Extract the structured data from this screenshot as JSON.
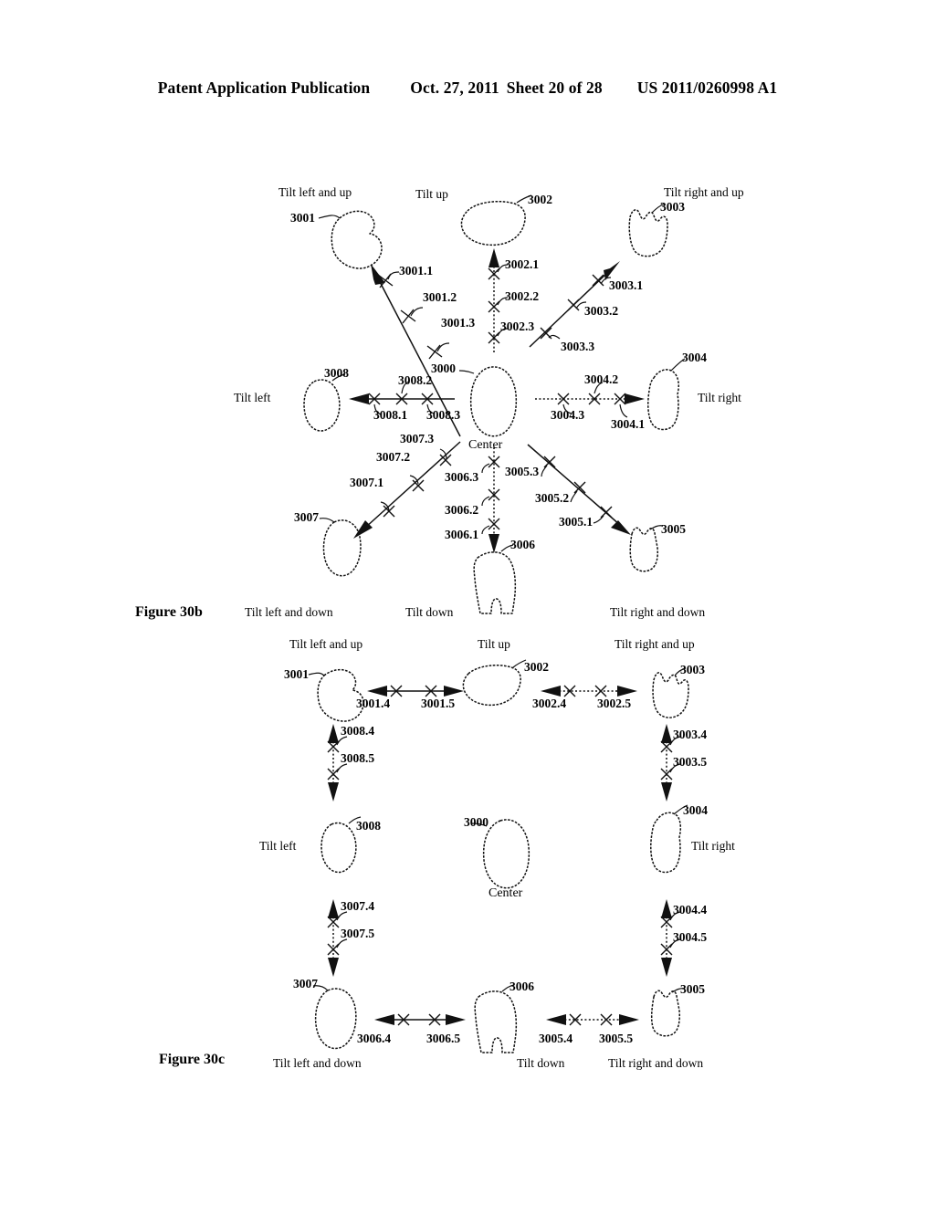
{
  "header": {
    "publication": "Patent Application Publication",
    "date": "Oct. 27, 2011",
    "sheet": "Sheet 20 of 28",
    "number": "US 2011/0260998 A1"
  },
  "figures": [
    {
      "name": "Figure 30b",
      "center": {
        "ref": "3000",
        "label": "Center"
      },
      "directions": [
        {
          "key": "tilt-left-and-up",
          "caption": "Tilt left and up",
          "shape_ref": "3001",
          "ticks": [
            "3001.1",
            "3001.2",
            "3001.3"
          ]
        },
        {
          "key": "tilt-up",
          "caption": "Tilt up",
          "shape_ref": "3002",
          "ticks": [
            "3002.1",
            "3002.2",
            "3002.3"
          ]
        },
        {
          "key": "tilt-right-and-up",
          "caption": "Tilt right and up",
          "shape_ref": "3003",
          "ticks": [
            "3003.1",
            "3003.2",
            "3003.3"
          ]
        },
        {
          "key": "tilt-right",
          "caption": "Tilt right",
          "shape_ref": "3004",
          "ticks": [
            "3004.1",
            "3004.2",
            "3004.3"
          ]
        },
        {
          "key": "tilt-right-and-down",
          "caption": "Tilt right and down",
          "shape_ref": "3005",
          "ticks": [
            "3005.1",
            "3005.2",
            "3005.3"
          ]
        },
        {
          "key": "tilt-down",
          "caption": "Tilt down",
          "shape_ref": "3006",
          "ticks": [
            "3006.1",
            "3006.2",
            "3006.3"
          ]
        },
        {
          "key": "tilt-left-and-down",
          "caption": "Tilt left and down",
          "shape_ref": "3007",
          "ticks": [
            "3007.1",
            "3007.2",
            "3007.3"
          ]
        },
        {
          "key": "tilt-left",
          "caption": "Tilt left",
          "shape_ref": "3008",
          "ticks": [
            "3008.1",
            "3008.2",
            "3008.3"
          ]
        }
      ]
    },
    {
      "name": "Figure 30c",
      "center": {
        "ref": "3000",
        "label": "Center"
      },
      "nodes": [
        {
          "key": "tilt-left-and-up",
          "caption": "Tilt left and up",
          "shape_ref": "3001"
        },
        {
          "key": "tilt-up",
          "caption": "Tilt up",
          "shape_ref": "3002"
        },
        {
          "key": "tilt-right-and-up",
          "caption": "Tilt right and up",
          "shape_ref": "3003"
        },
        {
          "key": "tilt-right",
          "caption": "Tilt right",
          "shape_ref": "3004"
        },
        {
          "key": "tilt-right-and-down",
          "caption": "Tilt right and down",
          "shape_ref": "3005"
        },
        {
          "key": "tilt-down",
          "caption": "Tilt down",
          "shape_ref": "3006"
        },
        {
          "key": "tilt-left-and-down",
          "caption": "Tilt left and down",
          "shape_ref": "3007"
        },
        {
          "key": "tilt-left",
          "caption": "Tilt left",
          "shape_ref": "3008"
        }
      ],
      "connectors": [
        {
          "key": "c-3001-3002",
          "ticks": [
            "3001.4",
            "3001.5"
          ]
        },
        {
          "key": "c-3002-3003",
          "ticks": [
            "3002.4",
            "3002.5"
          ]
        },
        {
          "key": "c-3003-3004",
          "ticks": [
            "3003.4",
            "3003.5"
          ]
        },
        {
          "key": "c-3004-3005",
          "ticks": [
            "3004.4",
            "3004.5"
          ]
        },
        {
          "key": "c-3005-3006",
          "ticks": [
            "3005.4",
            "3005.5"
          ]
        },
        {
          "key": "c-3006-3007",
          "ticks": [
            "3006.4",
            "3006.5"
          ]
        },
        {
          "key": "c-3007-3008",
          "ticks": [
            "3007.4",
            "3007.5"
          ]
        },
        {
          "key": "c-3008-3001",
          "ticks": [
            "3008.4",
            "3008.5"
          ]
        }
      ]
    }
  ]
}
